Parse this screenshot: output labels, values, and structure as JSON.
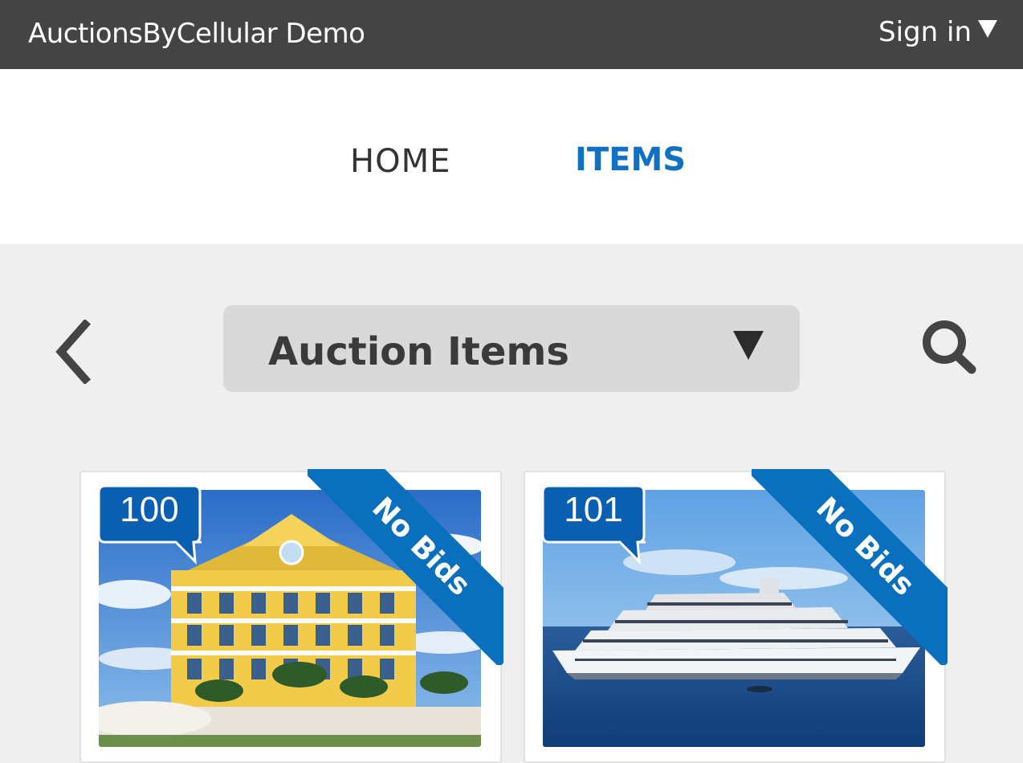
{
  "header": {
    "brand": "AuctionsByCellular Demo",
    "signin_label": "Sign in"
  },
  "nav": {
    "home_label": "HOME",
    "items_label": "ITEMS",
    "active": "ITEMS",
    "active_color": "#1071c2"
  },
  "toolbar": {
    "category_label": "Auction Items"
  },
  "items": [
    {
      "lot": "100",
      "ribbon": "No Bids",
      "image": "yellow beach house"
    },
    {
      "lot": "101",
      "ribbon": "No Bids",
      "image": "cruise ship"
    }
  ],
  "colors": {
    "topbar": "#444444",
    "ribbon": "#0a6fbd",
    "lot_badge": "#0a5fb0"
  }
}
